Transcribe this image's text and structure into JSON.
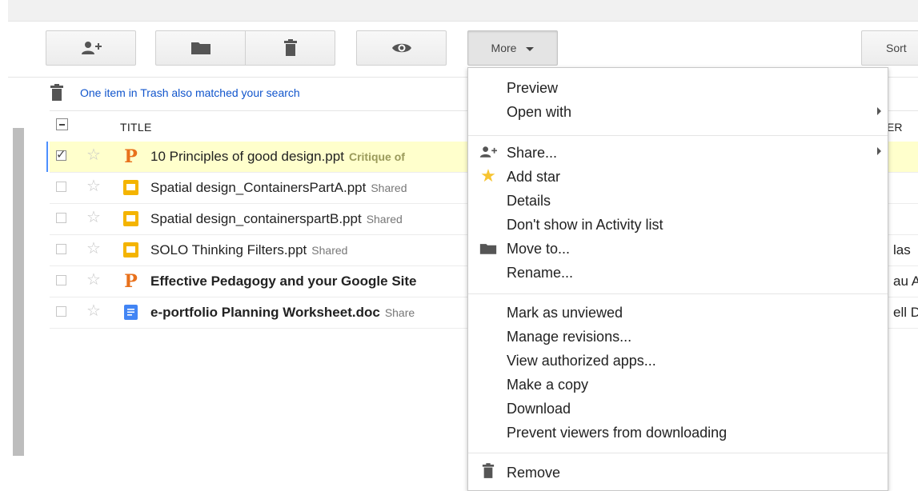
{
  "toolbar": {
    "add_people_icon": "add-person-icon",
    "folder_icon": "folder-icon",
    "trash_icon": "trash-icon",
    "preview_icon": "eye-icon",
    "more_label": "More",
    "sort_label": "Sort"
  },
  "trash_notice": "One item in Trash also matched your search",
  "list_header": {
    "title": "TITLE",
    "owner_partial": "ER"
  },
  "files": [
    {
      "name": "10 Principles of good design.ppt",
      "tag": "Critique of",
      "tag_bold": true,
      "icon": "presentation-p-icon",
      "bold": false,
      "checked": true,
      "selected": true,
      "owner": ""
    },
    {
      "name": "Spatial design_ContainersPartA.ppt",
      "tag": "Shared",
      "tag_bold": false,
      "icon": "slides-icon",
      "bold": false,
      "checked": false,
      "selected": false,
      "owner": ""
    },
    {
      "name": "Spatial design_containerspartB.ppt",
      "tag": "Shared",
      "tag_bold": false,
      "icon": "slides-icon",
      "bold": false,
      "checked": false,
      "selected": false,
      "owner": ""
    },
    {
      "name": "SOLO Thinking Filters.ppt",
      "tag": "Shared",
      "tag_bold": false,
      "icon": "slides-icon",
      "bold": false,
      "checked": false,
      "selected": false,
      "owner": "las"
    },
    {
      "name": "Effective Pedagogy and your Google Site",
      "tag": "",
      "tag_bold": false,
      "icon": "presentation-p-icon",
      "bold": true,
      "checked": false,
      "selected": false,
      "owner": "au A"
    },
    {
      "name": "e-portfolio Planning Worksheet.doc",
      "tag": "Share",
      "tag_bold": false,
      "icon": "document-icon",
      "bold": true,
      "checked": false,
      "selected": false,
      "owner": "ell D"
    }
  ],
  "menu": {
    "preview": "Preview",
    "open_with": "Open with",
    "share": "Share...",
    "add_star": "Add star",
    "details": "Details",
    "dont_show": "Don't show in Activity list",
    "move_to": "Move to...",
    "rename": "Rename...",
    "mark_unviewed": "Mark as unviewed",
    "manage_revisions": "Manage revisions...",
    "view_apps": "View authorized apps...",
    "make_copy": "Make a copy",
    "download": "Download",
    "prevent_download": "Prevent viewers from downloading",
    "remove": "Remove"
  },
  "colors": {
    "link": "#1155cc",
    "selected_row": "#ffffcc",
    "ppt_orange": "#e8711c",
    "slides_yellow": "#f4b400",
    "doc_blue": "#4285f4",
    "star_gold": "#f7c431"
  }
}
